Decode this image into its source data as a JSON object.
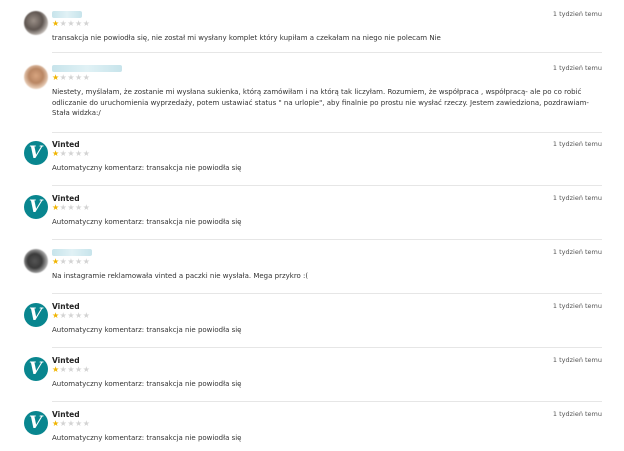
{
  "reviews": [
    {
      "type": "user",
      "name": "",
      "stars": 1,
      "time": "1 tydzień temu",
      "text": "transakcja nie powiodła się, nie został mi wysłany komplet który kupiłam a czekałam na niego nie polecam Nie"
    },
    {
      "type": "user",
      "name": "",
      "stars": 1,
      "time": "1 tydzień temu",
      "text": "Niestety, myślałam, że zostanie mi wysłana sukienka, którą zamówiłam i na którą tak liczyłam. Rozumiem, że współpraca , współpracą- ale po co robić odliczanie do uruchomienia wyprzedaży, potem ustawiać status \" na urlopie\", aby finalnie po prostu nie wysłać rzeczy. Jestem zawiedziona, pozdrawiam- Stała widzka:/"
    },
    {
      "type": "vinted",
      "name": "Vinted",
      "stars": 1,
      "time": "1 tydzień temu",
      "text": "Automatyczny komentarz: transakcja nie powiodła się"
    },
    {
      "type": "vinted",
      "name": "Vinted",
      "stars": 1,
      "time": "1 tydzień temu",
      "text": "Automatyczny komentarz: transakcja nie powiodła się"
    },
    {
      "type": "user",
      "name": "",
      "stars": 1,
      "time": "1 tydzień temu",
      "text": "Na instagramie reklamowała vinted a paczki nie wysłała. Mega przykro :("
    },
    {
      "type": "vinted",
      "name": "Vinted",
      "stars": 1,
      "time": "1 tydzień temu",
      "text": "Automatyczny komentarz: transakcja nie powiodła się"
    },
    {
      "type": "vinted",
      "name": "Vinted",
      "stars": 1,
      "time": "1 tydzień temu",
      "text": "Automatyczny komentarz: transakcja nie powiodła się"
    },
    {
      "type": "vinted",
      "name": "Vinted",
      "stars": 1,
      "time": "1 tydzień temu",
      "text": "Automatyczny komentarz: transakcja nie powiodła się"
    }
  ],
  "vinted_logo_letter": "V",
  "colors": {
    "vinted_teal": "#09868f",
    "star_filled": "#f0b400",
    "star_empty": "#d3d3d3"
  }
}
